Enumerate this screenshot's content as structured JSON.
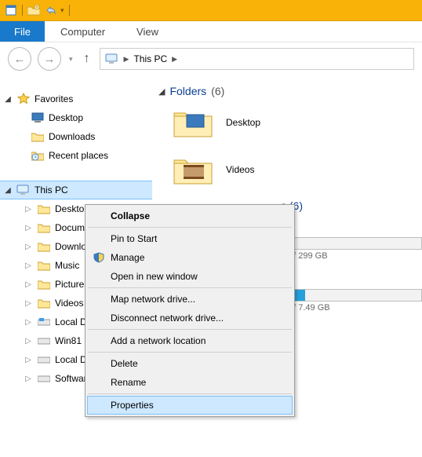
{
  "qat": {
    "dropdown": "▾"
  },
  "ribbon": {
    "file": "File",
    "computer": "Computer",
    "view": "View"
  },
  "breadcrumb": {
    "label": "This PC"
  },
  "nav": {
    "favorites": "Favorites",
    "desktop": "Desktop",
    "downloads": "Downloads",
    "recent": "Recent places",
    "thispc": "This PC",
    "child_desktop": "Desktop",
    "child_documents": "Documents",
    "child_downloads": "Downloads",
    "child_music": "Music",
    "child_pictures": "Pictures",
    "child_videos": "Videos",
    "child_localc": "Local Disk (C:)",
    "child_win81": "Win81 Beta (E:)",
    "child_localg": "Local Disk (G:)",
    "child_softwares": "Softwares (H:)"
  },
  "content": {
    "folders_head": "Folders",
    "folders_count": "(6)",
    "item_desktop": "Desktop",
    "item_videos": "Videos",
    "devices_head_trail": "s (6)",
    "drive_c_trail": ":)",
    "drive_c_free": "of 299 GB",
    "drive_h_trail": ":)",
    "drive_h_free": "of 7.49 GB"
  },
  "menu": {
    "collapse": "Collapse",
    "pin": "Pin to Start",
    "manage": "Manage",
    "open_new": "Open in new window",
    "map": "Map network drive...",
    "disconnect": "Disconnect network drive...",
    "add_loc": "Add a network location",
    "delete": "Delete",
    "rename": "Rename",
    "properties": "Properties"
  },
  "colors": {
    "accent": "#1979ca",
    "qat_bg": "#f8b208",
    "drive_blue": "#26a0da",
    "drive_gray": "#cfcfcf"
  }
}
